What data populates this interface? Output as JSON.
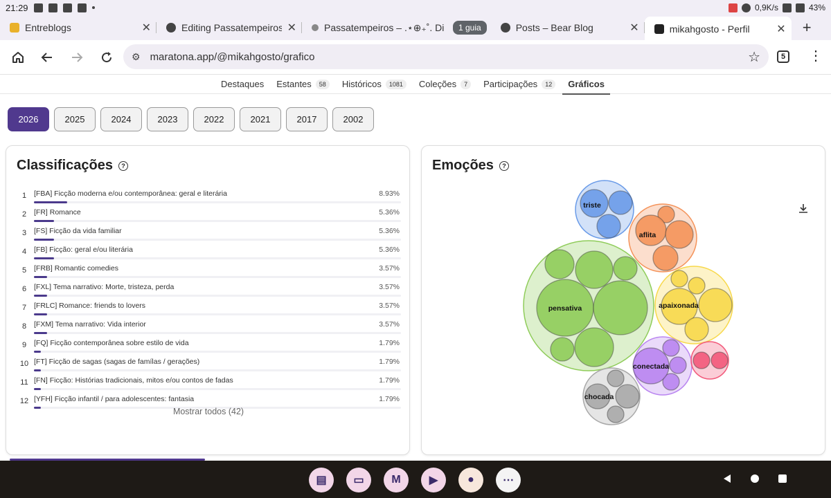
{
  "status_bar": {
    "time": "21:29",
    "net_speed": "0,9K/s",
    "battery": "43%"
  },
  "tabs": [
    {
      "label": "Entreblogs",
      "icon_color": "#e9b12b"
    },
    {
      "label": "Editing Passatempeiros – B",
      "icon_color": "#444444"
    },
    {
      "label": "Passatempeiros – .⋆⊕₊˚. Di",
      "icon_color": "#777777"
    },
    {
      "label": "Posts – Bear Blog",
      "icon_color": "#444444"
    },
    {
      "label": "mikahgosto - Perfil",
      "icon_color": "#222222"
    }
  ],
  "tab_group_label": "1 guia",
  "tab_count": "5",
  "address": {
    "url": "maratona.app/@mikahgosto/grafico"
  },
  "subnav": [
    {
      "label": "Destaques",
      "count": ""
    },
    {
      "label": "Estantes",
      "count": "58"
    },
    {
      "label": "Históricos",
      "count": "1081"
    },
    {
      "label": "Coleções",
      "count": "7"
    },
    {
      "label": "Participações",
      "count": "12"
    },
    {
      "label": "Gráficos",
      "count": ""
    }
  ],
  "years": [
    "2026",
    "2025",
    "2024",
    "2023",
    "2022",
    "2021",
    "2017",
    "2002"
  ],
  "classifications": {
    "title": "Classificações",
    "show_all": "Mostrar todos (42)",
    "rows": [
      {
        "rank": "1",
        "label": "[FBA] Ficção moderna e/ou contemporânea: geral e literária",
        "pct": "8.93%",
        "value": 8.93
      },
      {
        "rank": "2",
        "label": "[FR] Romance",
        "pct": "5.36%",
        "value": 5.36
      },
      {
        "rank": "3",
        "label": "[FS] Ficção da vida familiar",
        "pct": "5.36%",
        "value": 5.36
      },
      {
        "rank": "4",
        "label": "[FB] Ficção: geral e/ou literária",
        "pct": "5.36%",
        "value": 5.36
      },
      {
        "rank": "5",
        "label": "[FRB] Romantic comedies",
        "pct": "3.57%",
        "value": 3.57
      },
      {
        "rank": "6",
        "label": "[FXL] Tema narrativo: Morte, tristeza, perda",
        "pct": "3.57%",
        "value": 3.57
      },
      {
        "rank": "7",
        "label": "[FRLC] Romance: friends to lovers",
        "pct": "3.57%",
        "value": 3.57
      },
      {
        "rank": "8",
        "label": "[FXM] Tema narrativo: Vida interior",
        "pct": "3.57%",
        "value": 3.57
      },
      {
        "rank": "9",
        "label": "[FQ] Ficção contemporânea sobre estilo de vida",
        "pct": "1.79%",
        "value": 1.79
      },
      {
        "rank": "10",
        "label": "[FT] Ficção de sagas (sagas de famílas / gerações)",
        "pct": "1.79%",
        "value": 1.79
      },
      {
        "rank": "11",
        "label": "[FN] Ficção: Histórias tradicionais, mitos e/ou contos de fadas",
        "pct": "1.79%",
        "value": 1.79
      },
      {
        "rank": "12",
        "label": "[YFH] Ficção infantil / para adolescentes: fantasia",
        "pct": "1.79%",
        "value": 1.79
      }
    ]
  },
  "emotions": {
    "title": "Emoções",
    "groups": [
      {
        "label": "triste",
        "color": "#6a9be8"
      },
      {
        "label": "aflita",
        "color": "#f4935a"
      },
      {
        "label": "pensativa",
        "color": "#8fcc5a"
      },
      {
        "label": "apaixonada",
        "color": "#f7d84a"
      },
      {
        "label": "conectada",
        "color": "#b984f0"
      },
      {
        "label": "",
        "color": "#f2597a"
      },
      {
        "label": "chocada",
        "color": "#a8a8a8"
      }
    ]
  }
}
